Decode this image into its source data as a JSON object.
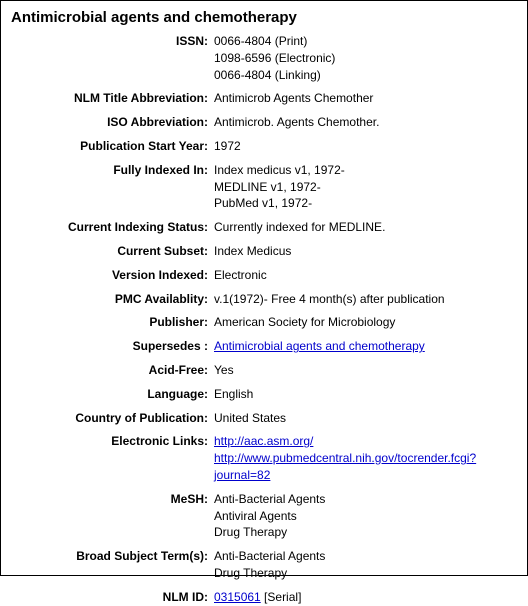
{
  "title": "Antimicrobial agents and chemotherapy",
  "fields": [
    {
      "label": "ISSN:",
      "lines": [
        "0066-4804 (Print)",
        "1098-6596 (Electronic)",
        "0066-4804 (Linking)"
      ]
    },
    {
      "label": "NLM Title Abbreviation:",
      "lines": [
        "Antimicrob Agents Chemother"
      ]
    },
    {
      "label": "ISO Abbreviation:",
      "lines": [
        "Antimicrob. Agents Chemother."
      ]
    },
    {
      "label": "Publication Start Year:",
      "lines": [
        "1972"
      ]
    },
    {
      "label": "Fully Indexed In:",
      "lines": [
        "Index medicus v1, 1972-",
        "MEDLINE v1, 1972-",
        "PubMed v1, 1972-"
      ]
    },
    {
      "label": "Current Indexing Status:",
      "lines": [
        "Currently indexed for MEDLINE."
      ]
    },
    {
      "label": "Current Subset:",
      "lines": [
        "Index Medicus"
      ]
    },
    {
      "label": "Version Indexed:",
      "lines": [
        "Electronic"
      ]
    },
    {
      "label": "PMC Availablity:",
      "lines": [
        "v.1(1972)- Free 4 month(s) after publication"
      ]
    },
    {
      "label": "Publisher:",
      "lines": [
        "American Society for Microbiology"
      ]
    },
    {
      "label": "Supersedes :",
      "links": [
        "Antimicrobial agents and chemotherapy"
      ]
    },
    {
      "label": "Acid-Free:",
      "lines": [
        "Yes"
      ]
    },
    {
      "label": "Language:",
      "lines": [
        "English"
      ]
    },
    {
      "label": "Country of Publication:",
      "lines": [
        "United States"
      ]
    },
    {
      "label": "Electronic Links:",
      "links": [
        "http://aac.asm.org/",
        "http://www.pubmedcentral.nih.gov/tocrender.fcgi?journal=82"
      ]
    },
    {
      "label": "MeSH:",
      "lines": [
        "Anti-Bacterial Agents",
        "Antiviral Agents",
        "Drug Therapy"
      ]
    },
    {
      "label": "Broad Subject Term(s):",
      "lines": [
        "Anti-Bacterial Agents",
        "Drug Therapy"
      ]
    },
    {
      "label": "NLM ID:",
      "links": [
        "0315061"
      ],
      "suffix": " [Serial]"
    }
  ]
}
